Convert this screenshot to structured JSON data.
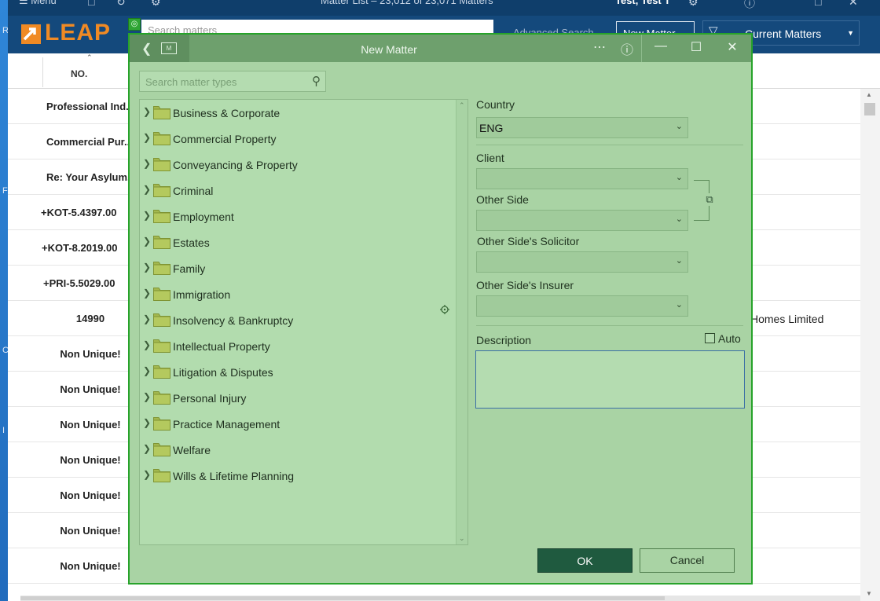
{
  "titlebar": {
    "menu": "☰ Menu",
    "title": "Matter List – 23,012 of 23,071 Matters",
    "user": "Test, Test T"
  },
  "header": {
    "logo": "LEAP",
    "search_placeholder": "Search matters",
    "advanced_search": "Advanced Search",
    "new_matter": "New Matter",
    "current_matters": "Current Matters"
  },
  "columns": {
    "no": "NO."
  },
  "rows": [
    {
      "no": "Professional Ind...",
      "extra": ""
    },
    {
      "no": "Commercial Pur...",
      "extra": ""
    },
    {
      "no": "Re: Your Asylum...",
      "extra": ""
    },
    {
      "no": "+KOT-5.4397.00",
      "extra": ""
    },
    {
      "no": "+KOT-8.2019.00",
      "extra": ""
    },
    {
      "no": "+PRI-5.5029.00",
      "extra": ""
    },
    {
      "no": "14990",
      "extra": "Homes Limited"
    },
    {
      "no": "Non Unique!",
      "extra": ""
    },
    {
      "no": "Non Unique!",
      "extra": ""
    },
    {
      "no": "Non Unique!",
      "extra": ""
    },
    {
      "no": "Non Unique!",
      "extra": ""
    },
    {
      "no": "Non Unique!",
      "extra": ""
    },
    {
      "no": "Non Unique!",
      "extra": ""
    },
    {
      "no": "Non Unique!",
      "extra": ""
    }
  ],
  "dialog": {
    "title": "New Matter",
    "search_placeholder": "Search matter types",
    "matter_types": [
      "Business & Corporate",
      "Commercial Property",
      "Conveyancing & Property",
      "Criminal",
      "Employment",
      "Estates",
      "Family",
      "Immigration",
      "Insolvency & Bankruptcy",
      "Intellectual Property",
      "Litigation & Disputes",
      "Personal Injury",
      "Practice Management",
      "Welfare",
      "Wills & Lifetime Planning"
    ],
    "country_label": "Country",
    "country_value": "ENG",
    "client_label": "Client",
    "other_side_label": "Other Side",
    "other_side_solicitor_label": "Other Side's Solicitor",
    "other_side_insurer_label": "Other Side's Insurer",
    "description_label": "Description",
    "auto_label": "Auto",
    "ok": "OK",
    "cancel": "Cancel"
  },
  "colors": {
    "dialog_bg": "#a9d3a4",
    "dialog_border": "#27a32a",
    "ok_button": "#1f5a3f",
    "leap_orange": "#f08a24",
    "app_header": "#14497c"
  }
}
